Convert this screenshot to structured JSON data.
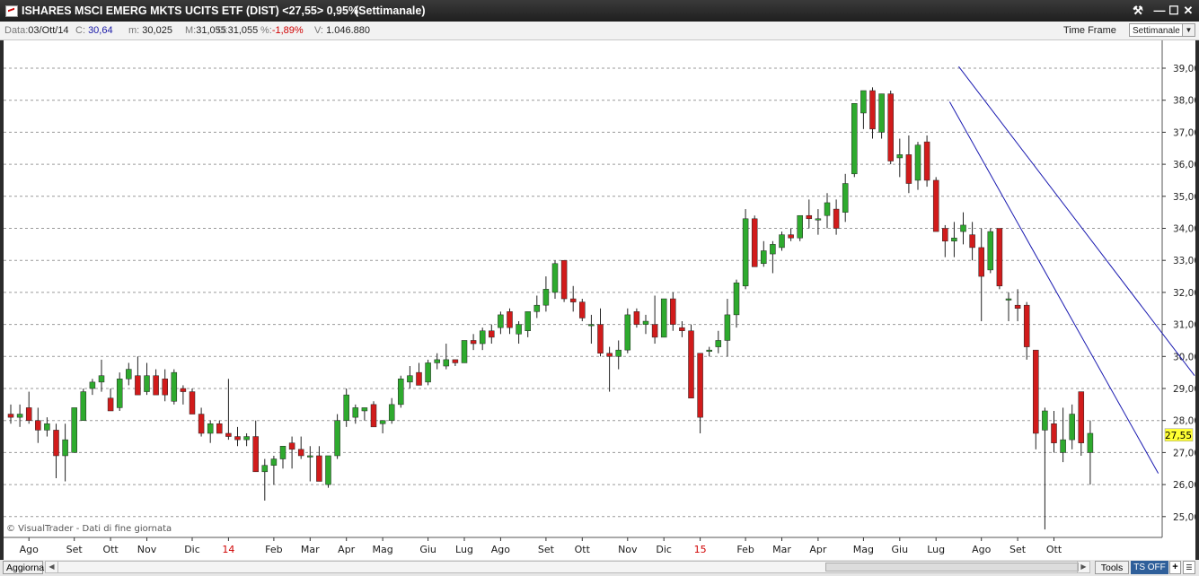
{
  "window": {
    "title": "ISHARES MSCI EMERG MKTS UCITS ETF (DIST) <27,55> 0,95%",
    "period": "(Settimanale)",
    "buttons": {
      "tools": "⚒",
      "minimize": "—",
      "maximize": "☐",
      "close": "✕"
    }
  },
  "info": {
    "date_label": "Data:",
    "date": "03/Ott/14",
    "close_label": "C:",
    "close": "30,64",
    "min_label": "m:",
    "min": "30,025",
    "max_label": "M:",
    "max": "31,055",
    "open_label": "O:",
    "open": "31,055",
    "pct_label": "%:",
    "pct": "-1,89%",
    "vol_label": "V:",
    "vol": "1.046.880",
    "timeframe_label": "Time Frame",
    "timeframe_value": "Settimanale"
  },
  "colors": {
    "up": "#2eaa2e",
    "down": "#d11b1b",
    "wick": "#222222",
    "channel": "#1a1ab0",
    "grid": "#9a9a9a",
    "price_tag": "#ffff33"
  },
  "chart_data": {
    "type": "candlestick",
    "ylim": [
      24.5,
      39.6
    ],
    "yticks": [
      "25,00",
      "26,00",
      "27,00",
      "28,00",
      "29,00",
      "30,00",
      "31,00",
      "32,00",
      "33,00",
      "34,00",
      "35,00",
      "36,00",
      "37,00",
      "38,00",
      "39,00"
    ],
    "last_price": "27,55",
    "copyright": "© VisualTrader - Dati di fine giornata",
    "xticks": [
      {
        "label": "Ago",
        "i": 2
      },
      {
        "label": "Set",
        "i": 7
      },
      {
        "label": "Ott",
        "i": 11
      },
      {
        "label": "Nov",
        "i": 15
      },
      {
        "label": "Dic",
        "i": 20
      },
      {
        "label": "14",
        "i": 24,
        "year": true
      },
      {
        "label": "Feb",
        "i": 29
      },
      {
        "label": "Mar",
        "i": 33
      },
      {
        "label": "Apr",
        "i": 37
      },
      {
        "label": "Mag",
        "i": 41
      },
      {
        "label": "Giu",
        "i": 46
      },
      {
        "label": "Lug",
        "i": 50
      },
      {
        "label": "Ago",
        "i": 54
      },
      {
        "label": "Set",
        "i": 59
      },
      {
        "label": "Ott",
        "i": 63
      },
      {
        "label": "Nov",
        "i": 68
      },
      {
        "label": "Dic",
        "i": 72
      },
      {
        "label": "15",
        "i": 76,
        "year": true
      },
      {
        "label": "Feb",
        "i": 81
      },
      {
        "label": "Mar",
        "i": 85
      },
      {
        "label": "Apr",
        "i": 89
      },
      {
        "label": "Mag",
        "i": 94
      },
      {
        "label": "Giu",
        "i": 98
      },
      {
        "label": "Lug",
        "i": 102
      },
      {
        "label": "Ago",
        "i": 107
      },
      {
        "label": "Set",
        "i": 111
      },
      {
        "label": "Ott",
        "i": 115
      }
    ],
    "candles": [
      [
        28.2,
        28.5,
        27.9,
        28.1
      ],
      [
        28.1,
        28.5,
        27.8,
        28.2
      ],
      [
        28.4,
        28.9,
        27.9,
        28.0
      ],
      [
        28.0,
        28.4,
        27.3,
        27.7
      ],
      [
        27.7,
        28.1,
        27.5,
        27.9
      ],
      [
        27.7,
        27.9,
        26.2,
        26.9
      ],
      [
        26.9,
        27.9,
        26.1,
        27.4
      ],
      [
        27.0,
        28.1,
        27.0,
        28.4
      ],
      [
        28.0,
        29.0,
        28.0,
        28.9
      ],
      [
        29.0,
        29.3,
        28.8,
        29.2
      ],
      [
        29.2,
        29.9,
        28.9,
        29.4
      ],
      [
        28.7,
        29.0,
        28.4,
        28.3
      ],
      [
        28.4,
        29.5,
        28.3,
        29.3
      ],
      [
        29.3,
        29.8,
        29.1,
        29.6
      ],
      [
        29.4,
        30.0,
        29.0,
        28.8
      ],
      [
        28.9,
        29.8,
        28.8,
        29.4
      ],
      [
        29.4,
        29.6,
        28.9,
        28.8
      ],
      [
        29.3,
        29.6,
        28.6,
        28.8
      ],
      [
        28.6,
        29.6,
        28.5,
        29.5
      ],
      [
        29.0,
        29.1,
        28.5,
        28.9
      ],
      [
        28.9,
        29.0,
        28.7,
        28.2
      ],
      [
        28.2,
        28.4,
        27.5,
        27.6
      ],
      [
        27.6,
        28.0,
        27.3,
        27.9
      ],
      [
        27.9,
        28.0,
        27.7,
        27.6
      ],
      [
        27.6,
        29.3,
        27.4,
        27.5
      ],
      [
        27.5,
        27.8,
        27.2,
        27.4
      ],
      [
        27.4,
        27.6,
        27.2,
        27.5
      ],
      [
        27.5,
        28.0,
        26.4,
        26.4
      ],
      [
        26.4,
        26.8,
        25.5,
        26.6
      ],
      [
        26.6,
        26.9,
        26.0,
        26.8
      ],
      [
        26.8,
        27.2,
        26.5,
        27.2
      ],
      [
        27.3,
        27.5,
        26.5,
        27.1
      ],
      [
        27.1,
        27.5,
        26.8,
        26.9
      ],
      [
        26.9,
        27.2,
        26.1,
        26.9
      ],
      [
        26.9,
        27.2,
        26.1,
        26.1
      ],
      [
        26.0,
        26.5,
        25.9,
        26.9
      ],
      [
        26.9,
        28.2,
        26.8,
        28.0
      ],
      [
        28.0,
        29.0,
        27.8,
        28.8
      ],
      [
        28.1,
        28.5,
        27.9,
        28.4
      ],
      [
        28.3,
        28.4,
        28.0,
        28.4
      ],
      [
        28.5,
        28.6,
        27.8,
        27.8
      ],
      [
        27.9,
        28.0,
        27.6,
        28.0
      ],
      [
        28.0,
        28.7,
        27.9,
        28.5
      ],
      [
        28.5,
        29.4,
        28.4,
        29.3
      ],
      [
        29.2,
        29.7,
        29.0,
        29.4
      ],
      [
        29.5,
        29.8,
        29.2,
        29.1
      ],
      [
        29.2,
        29.9,
        29.1,
        29.8
      ],
      [
        29.8,
        30.1,
        29.6,
        29.9
      ],
      [
        29.7,
        30.4,
        29.6,
        29.9
      ],
      [
        29.9,
        29.9,
        29.7,
        29.8
      ],
      [
        29.8,
        30.5,
        29.8,
        30.5
      ],
      [
        30.5,
        30.7,
        30.2,
        30.4
      ],
      [
        30.4,
        30.9,
        30.2,
        30.8
      ],
      [
        30.8,
        31.0,
        30.4,
        30.6
      ],
      [
        30.9,
        31.4,
        30.7,
        31.3
      ],
      [
        31.4,
        31.5,
        30.7,
        30.9
      ],
      [
        30.7,
        31.1,
        30.4,
        31.0
      ],
      [
        30.8,
        31.4,
        30.6,
        31.4
      ],
      [
        31.4,
        31.9,
        31.2,
        31.6
      ],
      [
        31.6,
        32.5,
        31.4,
        32.1
      ],
      [
        32.0,
        33.0,
        31.8,
        32.9
      ],
      [
        33.0,
        33.0,
        31.7,
        31.8
      ],
      [
        31.8,
        32.2,
        31.4,
        31.7
      ],
      [
        31.7,
        31.8,
        31.1,
        31.2
      ],
      [
        31.0,
        31.3,
        30.4,
        31.0
      ],
      [
        31.0,
        31.5,
        30.0,
        30.1
      ],
      [
        30.1,
        30.3,
        28.9,
        30.0
      ],
      [
        30.0,
        30.5,
        29.6,
        30.2
      ],
      [
        30.2,
        31.5,
        30.1,
        31.3
      ],
      [
        31.4,
        31.5,
        30.9,
        31.0
      ],
      [
        31.0,
        31.3,
        30.7,
        31.1
      ],
      [
        31.0,
        31.9,
        30.4,
        30.6
      ],
      [
        30.6,
        31.8,
        30.6,
        31.8
      ],
      [
        31.8,
        32.0,
        30.8,
        31.0
      ],
      [
        30.9,
        31.1,
        30.6,
        30.8
      ],
      [
        30.8,
        31.0,
        28.7,
        28.7
      ],
      [
        30.1,
        30.1,
        27.6,
        28.1
      ],
      [
        30.2,
        30.3,
        30.0,
        30.2
      ],
      [
        30.3,
        30.8,
        30.1,
        30.5
      ],
      [
        30.5,
        31.8,
        30.0,
        31.3
      ],
      [
        31.3,
        32.4,
        30.9,
        32.3
      ],
      [
        32.2,
        34.6,
        32.1,
        34.3
      ],
      [
        34.3,
        34.4,
        32.9,
        32.8
      ],
      [
        32.9,
        33.6,
        32.8,
        33.3
      ],
      [
        33.2,
        33.6,
        32.6,
        33.5
      ],
      [
        33.4,
        33.9,
        33.3,
        33.8
      ],
      [
        33.8,
        34.0,
        33.6,
        33.7
      ],
      [
        33.7,
        34.4,
        33.6,
        34.4
      ],
      [
        34.4,
        34.9,
        34.0,
        34.3
      ],
      [
        34.3,
        34.6,
        33.8,
        34.3
      ],
      [
        34.4,
        35.1,
        34.0,
        34.8
      ],
      [
        34.6,
        34.9,
        33.8,
        34.0
      ],
      [
        34.5,
        35.7,
        34.2,
        35.4
      ],
      [
        35.7,
        37.9,
        35.6,
        37.9
      ],
      [
        37.6,
        38.3,
        37.1,
        38.3
      ],
      [
        38.3,
        38.4,
        36.8,
        37.1
      ],
      [
        37.0,
        38.2,
        36.8,
        38.2
      ],
      [
        38.2,
        38.3,
        36.0,
        36.1
      ],
      [
        36.2,
        36.8,
        35.6,
        36.3
      ],
      [
        36.3,
        36.9,
        35.1,
        35.4
      ],
      [
        35.5,
        36.7,
        35.2,
        36.6
      ],
      [
        36.7,
        36.9,
        35.3,
        35.5
      ],
      [
        35.5,
        35.6,
        34.1,
        33.9
      ],
      [
        34.0,
        34.1,
        33.1,
        33.6
      ],
      [
        33.6,
        34.2,
        33.1,
        33.7
      ],
      [
        33.9,
        34.5,
        33.5,
        34.1
      ],
      [
        33.8,
        34.2,
        33.0,
        33.4
      ],
      [
        33.4,
        34.0,
        31.1,
        32.5
      ],
      [
        32.7,
        34.0,
        32.6,
        33.9
      ],
      [
        34.0,
        34.0,
        32.1,
        32.2
      ],
      [
        31.8,
        32.0,
        31.1,
        31.8
      ],
      [
        31.6,
        32.1,
        31.1,
        31.5
      ],
      [
        31.6,
        31.7,
        29.9,
        30.3
      ],
      [
        30.2,
        30.2,
        27.1,
        27.6
      ],
      [
        27.7,
        28.4,
        24.6,
        28.3
      ],
      [
        27.9,
        28.3,
        27.0,
        27.3
      ],
      [
        27.0,
        28.4,
        26.7,
        27.4
      ],
      [
        27.4,
        28.5,
        27.1,
        28.2
      ],
      [
        28.9,
        28.9,
        26.9,
        27.3
      ],
      [
        27.0,
        28.0,
        26.0,
        27.6
      ]
    ],
    "channel": {
      "upper": [
        [
          104.5,
          39.05
        ],
        [
          130.5,
          29.4
        ]
      ],
      "lower": [
        [
          103.5,
          37.95
        ],
        [
          126.5,
          26.35
        ]
      ]
    }
  },
  "bottombar": {
    "refresh": "Aggiorna",
    "tools": "Tools",
    "ts": "TS OFF",
    "plus": "+",
    "menu": "☰"
  }
}
